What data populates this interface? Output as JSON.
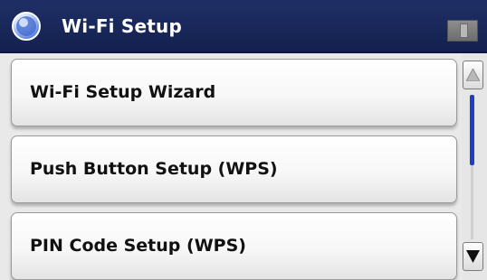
{
  "header": {
    "title": "Wi-Fi Setup",
    "icon": "globe-icon",
    "bar_color": "#1b2a5e"
  },
  "menu": {
    "items": [
      {
        "label": "Wi-Fi Setup Wizard"
      },
      {
        "label": "Push Button Setup (WPS)"
      },
      {
        "label": "PIN Code Setup (WPS)"
      }
    ]
  },
  "scrollbar": {
    "up_icon": "up-arrow-icon",
    "down_icon": "down-arrow-icon",
    "thumb_color": "#1f3fbf"
  }
}
